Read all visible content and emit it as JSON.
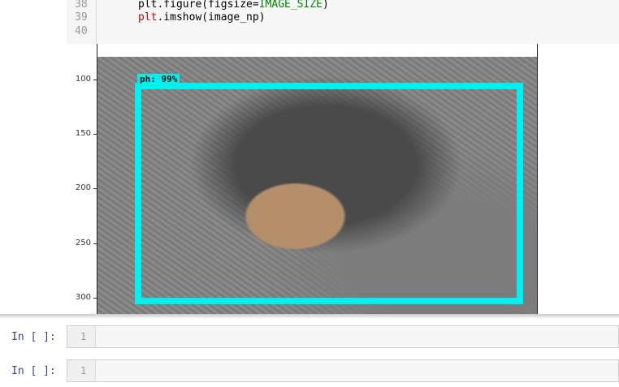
{
  "code_cell": {
    "lines": [
      {
        "num": "38",
        "pre": "plt.figure(figsize=",
        "kw": "IMAGE_SIZE",
        "post": ")"
      },
      {
        "num": "39",
        "pre": "",
        "kw": "plt",
        "post": ".imshow(image_np)"
      },
      {
        "num": "40",
        "pre": "",
        "kw": "",
        "post": ""
      }
    ]
  },
  "output": {
    "bbox_label": "ph: 99%",
    "bbox_color": "#00f0f0",
    "y_ticks": [
      "100",
      "150",
      "200",
      "250",
      "300"
    ]
  },
  "empty_cells": [
    {
      "prompt": "In [ ]:",
      "line_number": "1"
    },
    {
      "prompt": "In [ ]:",
      "line_number": "1"
    }
  ]
}
